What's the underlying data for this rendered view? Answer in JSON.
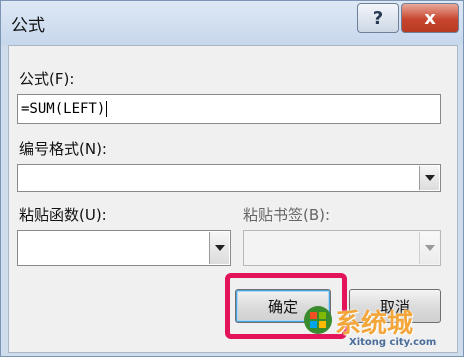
{
  "window": {
    "title": "公式",
    "help_glyph": "?",
    "close_glyph": "x"
  },
  "formula": {
    "label": "公式(F):",
    "value": "=SUM(LEFT)"
  },
  "number_format": {
    "label": "编号格式(N):",
    "value": ""
  },
  "paste_function": {
    "label": "粘贴函数(U):",
    "value": ""
  },
  "paste_bookmark": {
    "label": "粘贴书签(B):",
    "value": "",
    "disabled": true
  },
  "buttons": {
    "ok": "确定",
    "cancel": "取消"
  },
  "watermark": {
    "brand": "系统城",
    "url": "Xitong city.com"
  },
  "colors": {
    "highlight": "#e3145a",
    "close_button": "#c8452e"
  }
}
